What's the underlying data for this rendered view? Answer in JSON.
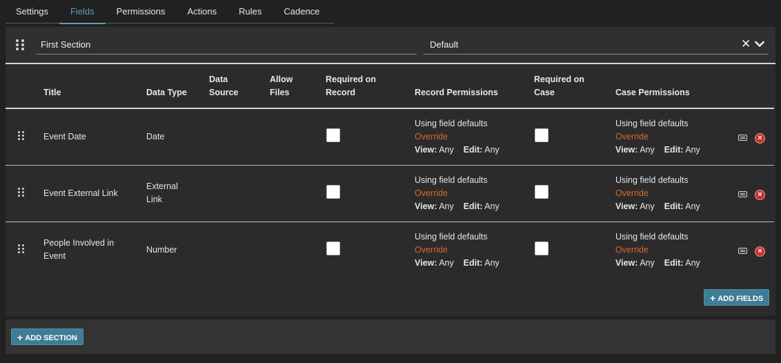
{
  "tabs": [
    {
      "label": "Settings",
      "active": false
    },
    {
      "label": "Fields",
      "active": true
    },
    {
      "label": "Permissions",
      "active": false
    },
    {
      "label": "Actions",
      "active": false
    },
    {
      "label": "Rules",
      "active": false
    },
    {
      "label": "Cadence",
      "active": false
    }
  ],
  "section": {
    "name": "First Section",
    "default_value": "Default",
    "clear_icon": "close-icon",
    "expand_icon": "chevron-down-icon"
  },
  "table": {
    "headers": {
      "title": "Title",
      "data_type": "Data Type",
      "data_source": "Data Source",
      "allow_files": "Allow Files",
      "required_on_record": "Required on Record",
      "record_permissions": "Record Permissions",
      "required_on_case": "Required on Case",
      "case_permissions": "Case Permissions"
    },
    "rows": [
      {
        "title": "Event Date",
        "data_type": "Date",
        "required_on_record": false,
        "required_on_case": false,
        "record_permissions": {
          "status": "Using field defaults",
          "override": "Override",
          "view_label": "View:",
          "view": "Any",
          "edit_label": "Edit:",
          "edit": "Any"
        },
        "case_permissions": {
          "status": "Using field defaults",
          "override": "Override",
          "view_label": "View:",
          "view": "Any",
          "edit_label": "Edit:",
          "edit": "Any"
        }
      },
      {
        "title": "Event External Link",
        "data_type": "External Link",
        "required_on_record": false,
        "required_on_case": false,
        "record_permissions": {
          "status": "Using field defaults",
          "override": "Override",
          "view_label": "View:",
          "view": "Any",
          "edit_label": "Edit:",
          "edit": "Any"
        },
        "case_permissions": {
          "status": "Using field defaults",
          "override": "Override",
          "view_label": "View:",
          "view": "Any",
          "edit_label": "Edit:",
          "edit": "Any"
        }
      },
      {
        "title": "People Involved in Event",
        "data_type": "Number",
        "required_on_record": false,
        "required_on_case": false,
        "record_permissions": {
          "status": "Using field defaults",
          "override": "Override",
          "view_label": "View:",
          "view": "Any",
          "edit_label": "Edit:",
          "edit": "Any"
        },
        "case_permissions": {
          "status": "Using field defaults",
          "override": "Override",
          "view_label": "View:",
          "view": "Any",
          "edit_label": "Edit:",
          "edit": "Any"
        }
      }
    ]
  },
  "buttons": {
    "add_fields": "ADD FIELDS",
    "add_section": "ADD SECTION"
  },
  "colors": {
    "accent": "#5f9fb6",
    "button": "#3f7d96",
    "override": "#d86b2a",
    "delete": "#c9302c"
  }
}
